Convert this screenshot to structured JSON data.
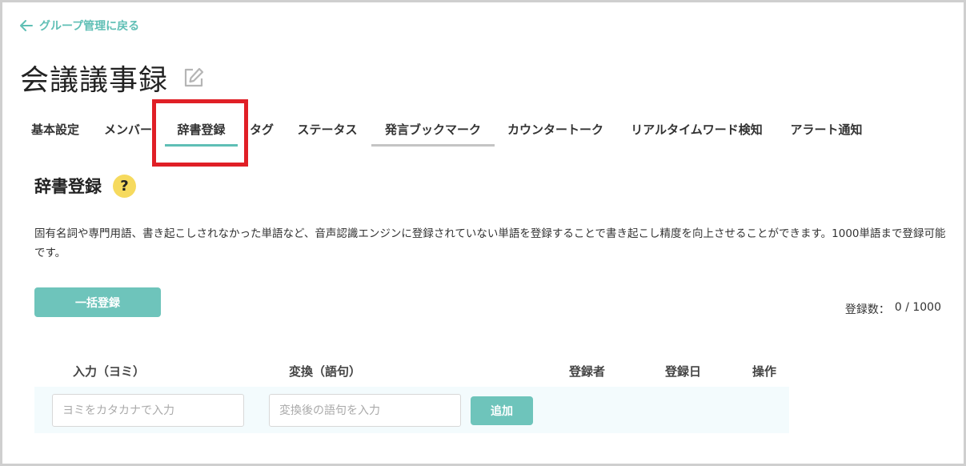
{
  "back_link": {
    "label": "グループ管理に戻る",
    "icon": "arrow-left-icon"
  },
  "page": {
    "title": "会議議事録",
    "edit_icon": "pencil-edit-icon"
  },
  "tabs": [
    {
      "label": "基本設定"
    },
    {
      "label": "メンバー"
    },
    {
      "label": "辞書登録",
      "active": true
    },
    {
      "label": "タグ"
    },
    {
      "label": "ステータス"
    },
    {
      "label": "発言ブックマーク",
      "hovered": true
    },
    {
      "label": "カウンタートーク"
    },
    {
      "label": "リアルタイムワード検知"
    },
    {
      "label": "アラート通知"
    }
  ],
  "section": {
    "title": "辞書登録",
    "help_label": "?",
    "description": "固有名詞や専門用語、書き起こしされなかった単語など、音声認識エンジンに登録されていない単語を登録することで書き起こし精度を向上させることができます。1000単語まで登録可能です。"
  },
  "bulk_button": {
    "label": "一括登録"
  },
  "count": {
    "label": "登録数：",
    "value": "0 / 1000"
  },
  "table": {
    "headers": [
      "入力（ヨミ）",
      "変換（語句）",
      "登録者",
      "登録日",
      "操作"
    ],
    "reading_placeholder": "ヨミをカタカナで入力",
    "phrase_placeholder": "変換後の語句を入力",
    "add_label": "追加"
  },
  "colors": {
    "accent": "#6ec4bb",
    "link": "#5fbfb5",
    "highlight_box": "#e01f26",
    "help_badge": "#f6da5e",
    "row_bg": "#f3fbfd"
  }
}
